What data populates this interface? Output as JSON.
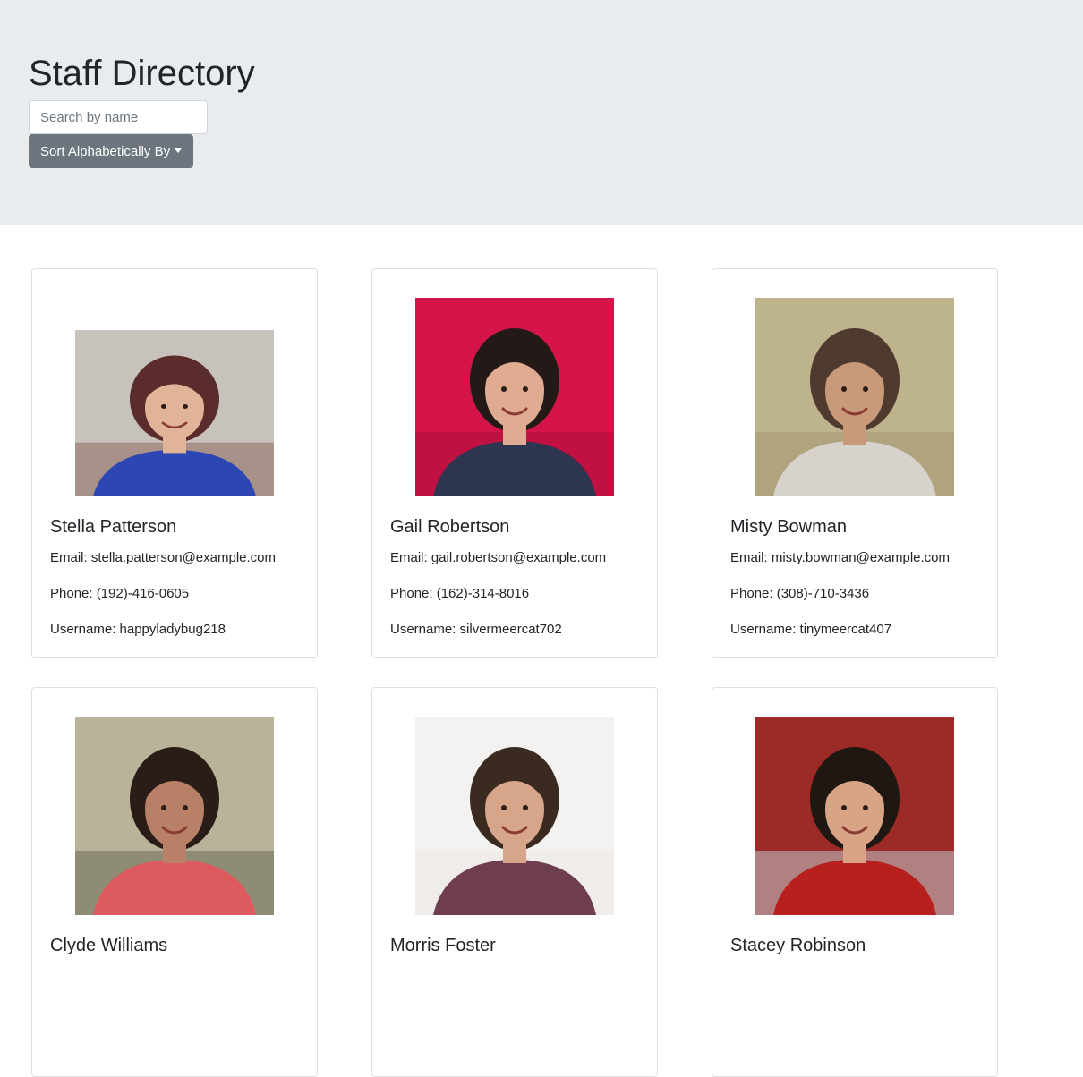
{
  "header": {
    "title": "Staff Directory",
    "search_placeholder": "Search by name",
    "search_value": "",
    "sort_label": "Sort Alphabetically By"
  },
  "labels": {
    "email": "Email:",
    "phone": "Phone:",
    "username": "Username:"
  },
  "employees": [
    {
      "name": "Stella Patterson",
      "email": "stella.patterson@example.com",
      "phone": "(192)-416-0605",
      "username": "happyladybug218",
      "photo_colors": [
        "#c8c2bd",
        "#8c6a5e",
        "#5a2c2c",
        "#e1b49a",
        "#2d46b4"
      ]
    },
    {
      "name": "Gail Robertson",
      "email": "gail.robertson@example.com",
      "phone": "(162)-314-8016",
      "username": "silvermeercat702",
      "photo_colors": [
        "#d5154a",
        "#b00f3c",
        "#231a18",
        "#dfac92",
        "#2e3550"
      ]
    },
    {
      "name": "Misty Bowman",
      "email": "misty.bowman@example.com",
      "phone": "(308)-710-3436",
      "username": "tinymeercat407",
      "photo_colors": [
        "#bdb48e",
        "#a69873",
        "#4e3a2e",
        "#c99a7a",
        "#d8d2cc"
      ]
    },
    {
      "name": "Clyde Williams",
      "email": "",
      "phone": "",
      "username": "",
      "photo_colors": [
        "#b9b39a",
        "#6c6b58",
        "#2a1d17",
        "#b88066",
        "#dd5a5e"
      ]
    },
    {
      "name": "Morris Foster",
      "email": "",
      "phone": "",
      "username": "",
      "photo_colors": [
        "#f4f2f0",
        "#ece8e4",
        "#3b2a20",
        "#d6a58a",
        "#6e3d4f"
      ]
    },
    {
      "name": "Stacey Robinson",
      "email": "",
      "phone": "",
      "username": "",
      "photo_colors": [
        "#9c2a26",
        "#c3c7cc",
        "#1f1712",
        "#d9a486",
        "#b7201d"
      ]
    }
  ]
}
